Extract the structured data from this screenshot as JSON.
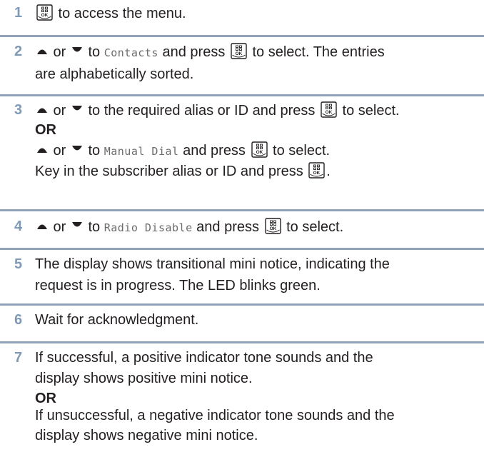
{
  "steps": [
    {
      "num": "1",
      "lines": [
        {
          "parts": [
            {
              "t": "key"
            },
            {
              "t": "text",
              "v": " to access the menu."
            }
          ]
        }
      ]
    },
    {
      "num": "2",
      "lines": [
        {
          "parts": [
            {
              "t": "up"
            },
            {
              "t": "text",
              "v": " or "
            },
            {
              "t": "down"
            },
            {
              "t": "text",
              "v": " to "
            },
            {
              "t": "mono",
              "v": "Contacts"
            },
            {
              "t": "text",
              "v": " and press "
            },
            {
              "t": "key"
            },
            {
              "t": "text",
              "v": " to select. The entries"
            }
          ]
        },
        {
          "parts": [
            {
              "t": "text",
              "v": "are alphabetically sorted."
            }
          ]
        }
      ]
    },
    {
      "num": "3",
      "lines": [
        {
          "parts": [
            {
              "t": "up"
            },
            {
              "t": "text",
              "v": " or "
            },
            {
              "t": "down"
            },
            {
              "t": "text",
              "v": " to the required alias or ID and press "
            },
            {
              "t": "key"
            },
            {
              "t": "text",
              "v": " to select."
            }
          ]
        },
        {
          "parts": [
            {
              "t": "bold",
              "v": "OR"
            }
          ]
        },
        {
          "parts": [
            {
              "t": "up"
            },
            {
              "t": "text",
              "v": " or "
            },
            {
              "t": "down"
            },
            {
              "t": "text",
              "v": " to "
            },
            {
              "t": "mono",
              "v": "Manual Dial"
            },
            {
              "t": "text",
              "v": " and press "
            },
            {
              "t": "key"
            },
            {
              "t": "text",
              "v": " to select."
            }
          ]
        },
        {
          "parts": [
            {
              "t": "text",
              "v": "Key in the subscriber alias or ID and press "
            },
            {
              "t": "key"
            },
            {
              "t": "text",
              "v": "."
            }
          ]
        }
      ]
    },
    {
      "num": "4",
      "lines": [
        {
          "parts": [
            {
              "t": "up"
            },
            {
              "t": "text",
              "v": " or "
            },
            {
              "t": "down"
            },
            {
              "t": "text",
              "v": " to "
            },
            {
              "t": "mono",
              "v": "Radio Disable"
            },
            {
              "t": "text",
              "v": " and press "
            },
            {
              "t": "key"
            },
            {
              "t": "text",
              "v": " to select."
            }
          ]
        }
      ]
    },
    {
      "num": "5",
      "lines": [
        {
          "parts": [
            {
              "t": "text",
              "v": " The display shows transitional mini notice, indicating the"
            }
          ]
        },
        {
          "parts": [
            {
              "t": "text",
              "v": "request is in progress. The LED blinks green."
            }
          ]
        }
      ]
    },
    {
      "num": "6",
      "lines": [
        {
          "parts": [
            {
              "t": "text",
              "v": "Wait for acknowledgment."
            }
          ]
        }
      ]
    },
    {
      "num": "7",
      "lines": [
        {
          "parts": [
            {
              "t": "text",
              "v": "If successful, a positive indicator tone sounds and the"
            }
          ]
        },
        {
          "parts": [
            {
              "t": "text",
              "v": "display shows positive mini notice."
            }
          ]
        },
        {
          "parts": [
            {
              "t": "bold",
              "v": "OR"
            }
          ]
        },
        {
          "parts": [
            {
              "t": "text",
              "v": "If unsuccessful, a negative indicator tone sounds and the"
            }
          ]
        },
        {
          "parts": [
            {
              "t": "text",
              "v": "display shows negative mini notice."
            }
          ]
        }
      ]
    }
  ],
  "icons": {
    "menu_key": "menu-ok-key-icon",
    "up": "up-arrow-icon",
    "down": "down-arrow-icon"
  },
  "colors": {
    "number": "#7f9ab6",
    "rule": "#8fa2b8",
    "text": "#231f20",
    "mono": "#6b6b6b"
  }
}
